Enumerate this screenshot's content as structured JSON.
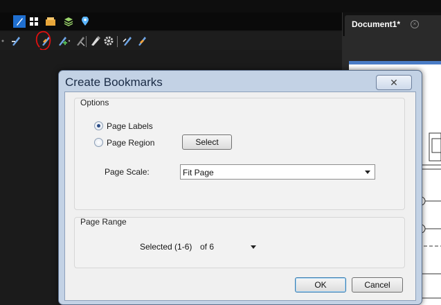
{
  "toolbar": {
    "top_icons": [
      "markup-tool-icon",
      "grid-icon",
      "toolchest-icon",
      "layers-icon",
      "location-icon"
    ],
    "bookmark_icons": [
      "add-bookmark-icon",
      "create-bookmarks-icon",
      "add-child-bookmark-icon",
      "remove-bookmark-icon",
      "edit-bookmark-icon",
      "bookmark-settings-icon",
      "bookmark-tool-a-icon",
      "bookmark-tool-b-icon"
    ]
  },
  "document_tab": {
    "label": "Document1*"
  },
  "dialog": {
    "title": "Create Bookmarks",
    "close_glyph": "✕",
    "options": {
      "group_title": "Options",
      "page_labels": "Page Labels",
      "page_region": "Page Region",
      "select_button": "Select",
      "page_scale_label": "Page Scale:",
      "page_scale_value": "Fit Page",
      "selected_radio": "page_labels"
    },
    "page_range": {
      "group_title": "Page Range",
      "value": "Selected (1-6)",
      "of_text": "of 6"
    },
    "ok": "OK",
    "cancel": "Cancel"
  },
  "colors": {
    "accent": "#1f6fd0",
    "dialog_frame": "#c3d2e5",
    "annotation": "#e01010"
  }
}
